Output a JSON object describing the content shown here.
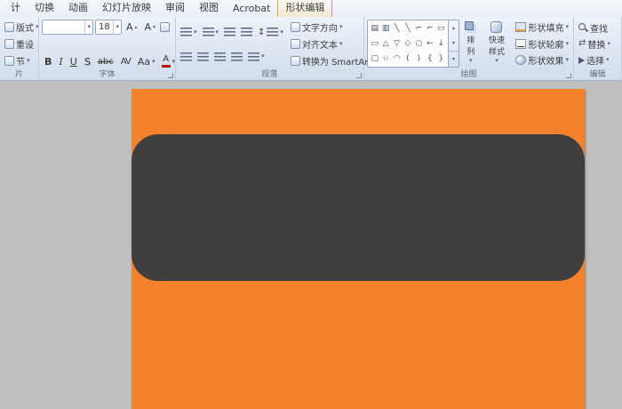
{
  "colors": {
    "canvas_bg": "#bfbfbf",
    "slide_bg": "#f5812c",
    "shape_fill": "#3f3f3f"
  },
  "menubar": {
    "tabs": [
      "计",
      "切换",
      "动画",
      "幻灯片放映",
      "审阅",
      "视图",
      "Acrobat",
      "形状编辑"
    ],
    "active_tab": "形状编辑"
  },
  "ribbon": {
    "slides": {
      "label": "片",
      "layout": "版式",
      "reset": "重设",
      "section": "节"
    },
    "font": {
      "label": "字体",
      "font_name_value": "",
      "size_value": "18",
      "grow": "A",
      "shrink": "A",
      "bold": "B",
      "italic": "I",
      "underline": "U",
      "shadow": "S",
      "strike": "abc",
      "spacing": "AV",
      "case": "Aa",
      "color": "A"
    },
    "paragraph": {
      "label": "段落",
      "text_direction": "文字方向",
      "align_text": "对齐文本",
      "smartart": "转换为 SmartArt"
    },
    "drawing": {
      "label": "绘图",
      "arrange": "排列",
      "quick_styles": "快速样式",
      "shape_fill": "形状填充",
      "shape_outline": "形状轮廓",
      "shape_effects": "形状效果",
      "shapes_row1": [
        "▤",
        "▥",
        "╲",
        "╲",
        "⌐",
        "⌐",
        "▭"
      ],
      "shapes_row2": [
        "▭",
        "△",
        "▽",
        "◇",
        "○",
        "←",
        "↓"
      ],
      "shapes_row3": [
        "▢",
        "☆",
        "◠",
        "(",
        ")",
        "{",
        "}"
      ]
    },
    "editing": {
      "label": "编辑",
      "find": "查找",
      "replace": "替换",
      "select": "选择"
    }
  },
  "icons": {
    "dropdown": "▾",
    "scroll_up": "▴",
    "scroll_down": "▾",
    "more": "▾",
    "replace": "⇄",
    "updown": "↕"
  }
}
